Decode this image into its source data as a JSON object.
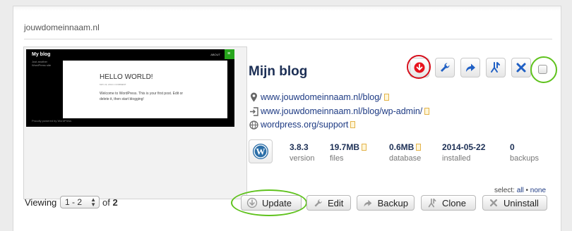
{
  "site": {
    "domain": "jouwdomeinnaam.nl",
    "title": "Mijn blog"
  },
  "thumbnail": {
    "blog_title": "My blog",
    "tagline": "Just another WordPress site",
    "menu_item": "ABOUT",
    "post_title": "HELLO WORLD!",
    "post_meta": "MAY 22, 2014   1 COMMENT",
    "post_excerpt": "Welcome to WordPress. This is your first post. Edit or delete it, then start blogging!",
    "footer": "Proudly powered by WordPress"
  },
  "actions": {
    "update_icon": "arrow-down-circle-icon",
    "settings_icon": "wrench-icon",
    "login_icon": "share-arrow-icon",
    "clone_icon": "clone-icon",
    "remove_icon": "x-icon"
  },
  "links": [
    {
      "icon": "location-pin-icon",
      "text": "www.jouwdomeinnaam.nl/blog/"
    },
    {
      "icon": "login-icon",
      "text": "www.jouwdomeinnaam.nl/blog/wp-admin/"
    },
    {
      "icon": "globe-icon",
      "text": "wordpress.org/support"
    }
  ],
  "stats": {
    "version": {
      "value": "3.8.3",
      "label": "version"
    },
    "files": {
      "value": "19.7MB",
      "label": "files"
    },
    "database": {
      "value": "0.6MB",
      "label": "database"
    },
    "installed": {
      "value": "2014-05-22",
      "label": "installed"
    },
    "backups": {
      "value": "0",
      "label": "backups"
    }
  },
  "footer": {
    "viewing_label": "Viewing",
    "pager_value": "1 - 2",
    "of_label": "of",
    "total": "2",
    "select_label": "select:",
    "select_all": "all",
    "select_sep": "•",
    "select_none": "none"
  },
  "buttons": {
    "update": "Update",
    "edit": "Edit",
    "backup": "Backup",
    "clone": "Clone",
    "uninstall": "Uninstall"
  },
  "colors": {
    "accent_blue": "#1f5fc4",
    "highlight_red": "#d60f1c",
    "highlight_green": "#5fc21d",
    "link": "#1d3a83"
  }
}
